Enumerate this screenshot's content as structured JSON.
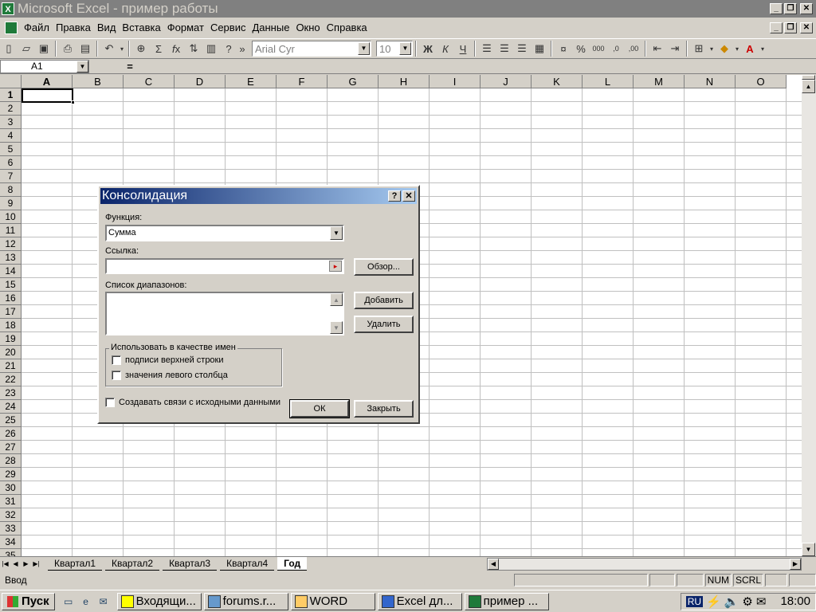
{
  "window": {
    "title": "Microsoft Excel - пример работы",
    "icon": "excel-icon"
  },
  "menu": {
    "items": [
      {
        "label": "Файл"
      },
      {
        "label": "Правка"
      },
      {
        "label": "Вид"
      },
      {
        "label": "Вставка"
      },
      {
        "label": "Формат"
      },
      {
        "label": "Сервис"
      },
      {
        "label": "Данные"
      },
      {
        "label": "Окно"
      },
      {
        "label": "Справка"
      }
    ]
  },
  "toolbar": {
    "font": "Arial Cyr",
    "size": "10"
  },
  "formula_bar": {
    "name_box": "A1",
    "equals": "="
  },
  "grid": {
    "columns": [
      "A",
      "B",
      "C",
      "D",
      "E",
      "F",
      "G",
      "H",
      "I",
      "J",
      "K",
      "L",
      "M",
      "N",
      "O"
    ],
    "rows": [
      "1",
      "2",
      "3",
      "4",
      "5",
      "6",
      "7",
      "8",
      "9",
      "10",
      "11",
      "12",
      "13",
      "14",
      "15",
      "16",
      "17",
      "18",
      "19",
      "20",
      "21",
      "22",
      "23",
      "24",
      "25",
      "26",
      "27",
      "28",
      "29",
      "30",
      "31",
      "32",
      "33",
      "34",
      "35"
    ],
    "selected_cell": "A1"
  },
  "sheets": {
    "tabs": [
      "Квартал1",
      "Квартал2",
      "Квартал3",
      "Квартал4",
      "Год"
    ],
    "active": "Год"
  },
  "status": {
    "mode": "Ввод",
    "num": "NUM",
    "scrl": "SCRL"
  },
  "taskbar": {
    "start": "Пуск",
    "buttons": [
      "Входящи...",
      "forums.r...",
      "WORD",
      "Excel дл...",
      "пример ..."
    ],
    "lang": "RU",
    "clock": "18:00"
  },
  "dialog": {
    "title": "Консолидация",
    "function_label": "Функция:",
    "function_value": "Сумма",
    "reference_label": "Ссылка:",
    "reference_value": "",
    "browse_button": "Обзор...",
    "ranges_label": "Список диапазонов:",
    "add_button": "Добавить",
    "delete_button": "Удалить",
    "group_label": "Использовать в качестве имен",
    "top_row_label": "подписи верхней строки",
    "left_column_label": "значения левого столбца",
    "create_links_label": "Создавать связи с исходными данными",
    "ok_button": "ОК",
    "close_button": "Закрыть"
  }
}
